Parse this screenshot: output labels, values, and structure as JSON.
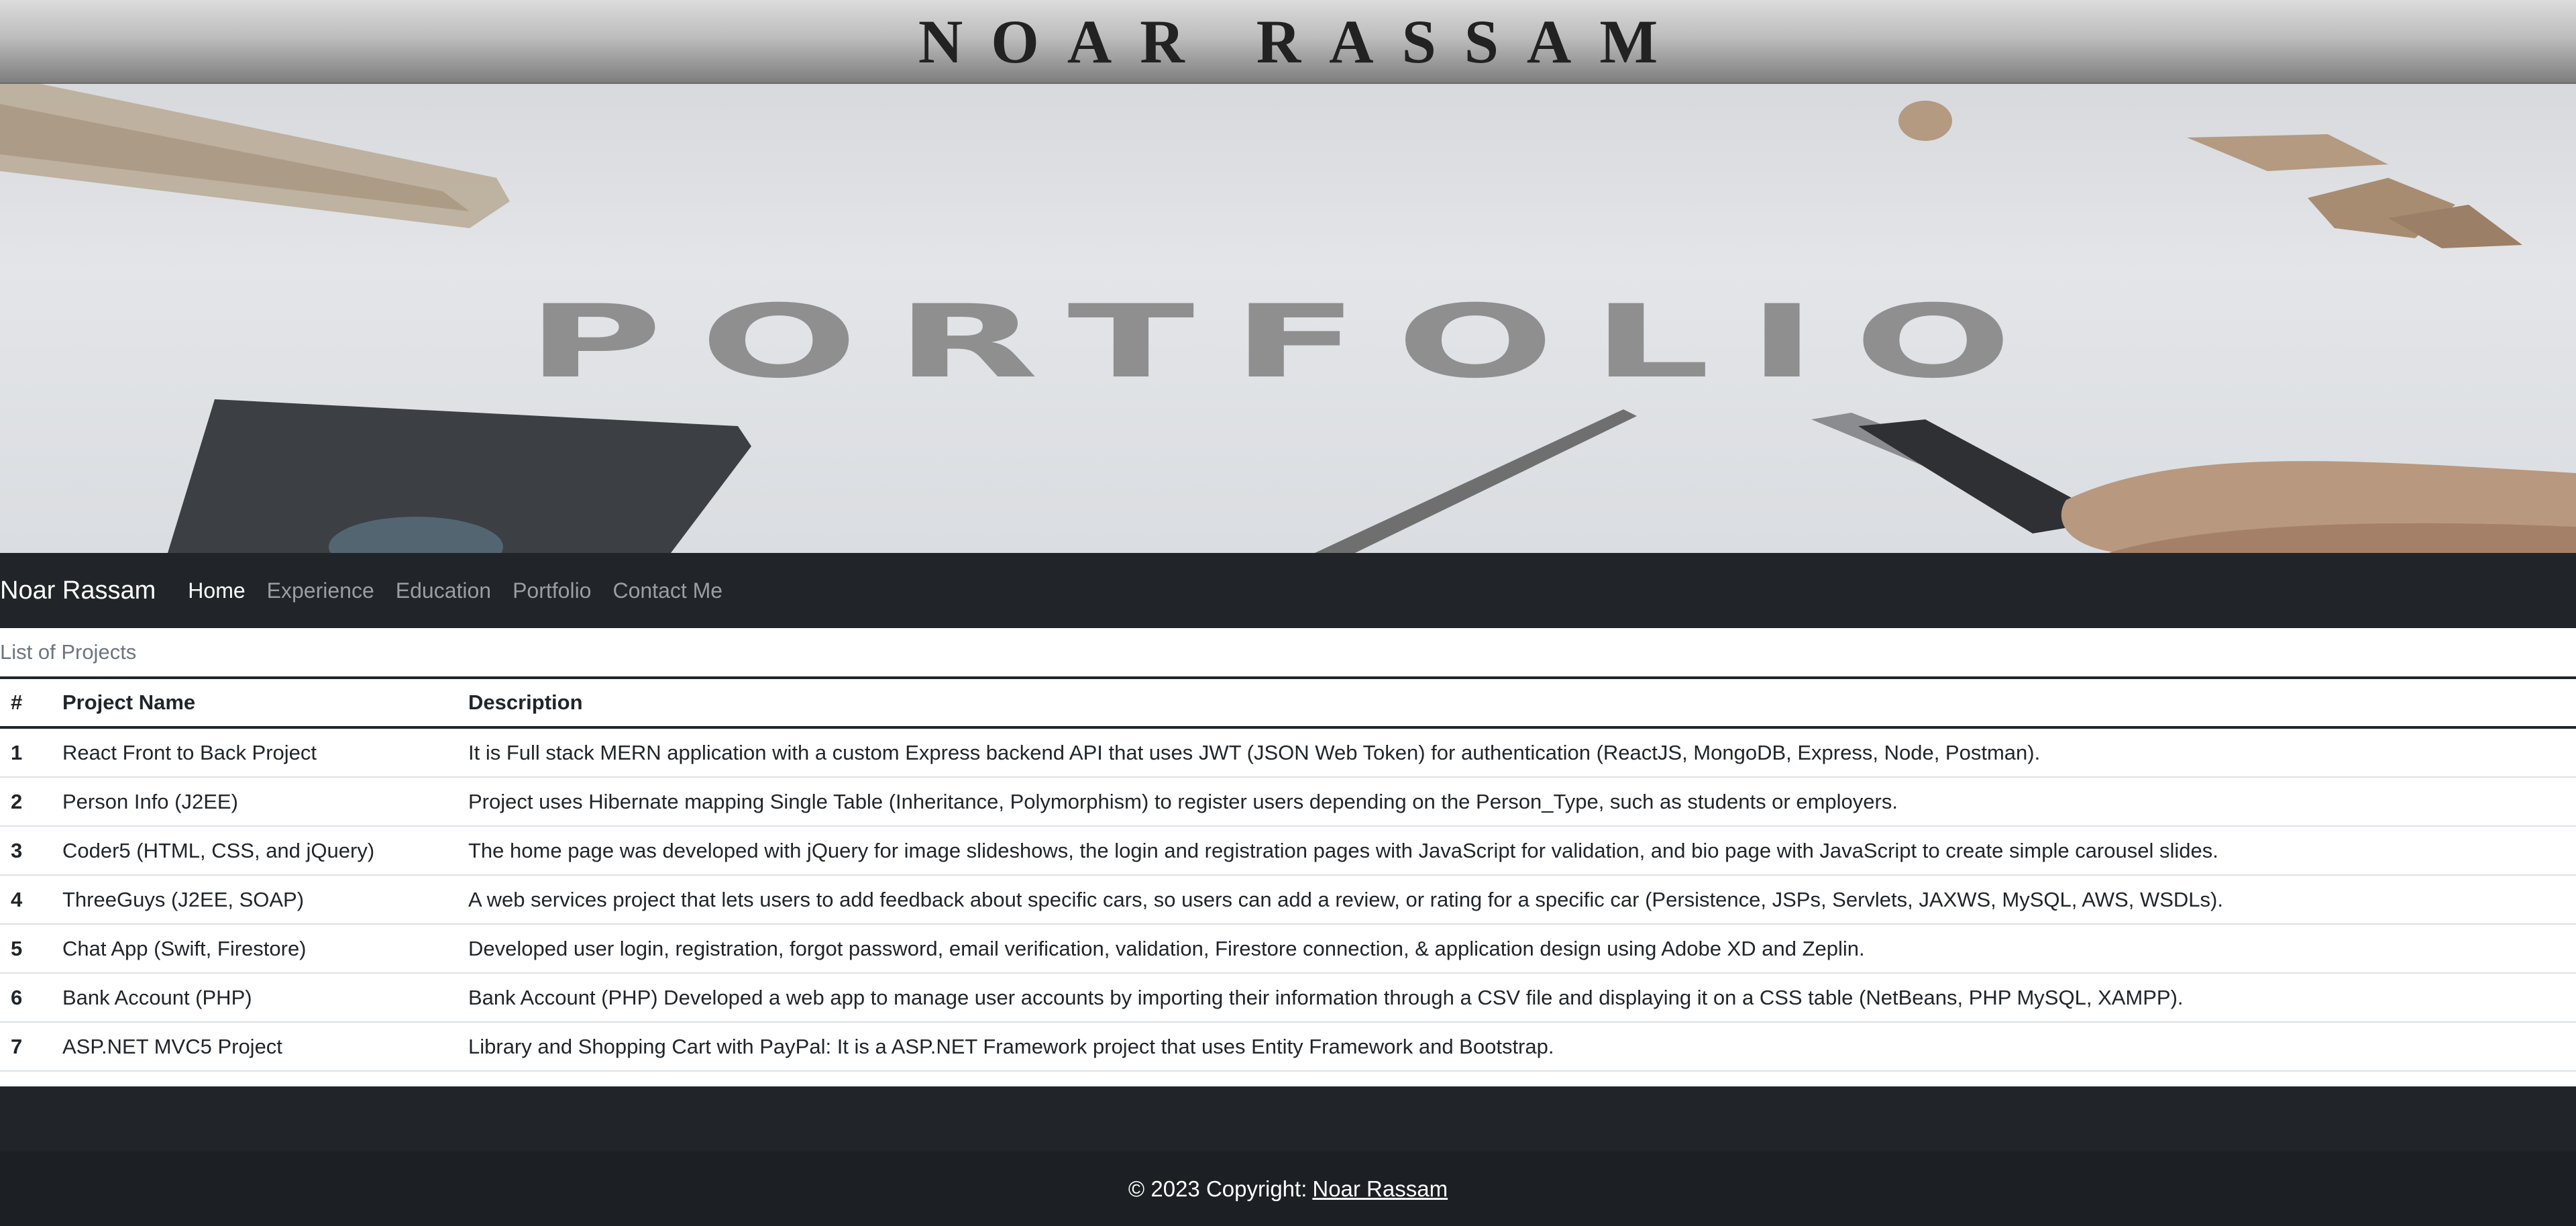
{
  "header": {
    "site_name": "NOAR RASSAM"
  },
  "hero": {
    "title": "PORTFOLIO"
  },
  "navbar": {
    "brand": "Noar Rassam",
    "links": [
      {
        "label": "Home",
        "active": true
      },
      {
        "label": "Experience",
        "active": false
      },
      {
        "label": "Education",
        "active": false
      },
      {
        "label": "Portfolio",
        "active": false
      },
      {
        "label": "Contact Me",
        "active": false
      }
    ]
  },
  "projects": {
    "caption": "List of Projects",
    "columns": [
      "#",
      "Project Name",
      "Description"
    ],
    "rows": [
      {
        "num": "1",
        "name": "React Front to Back Project",
        "description": "It is Full stack MERN application with a custom Express backend API that uses JWT (JSON Web Token) for authentication (ReactJS, MongoDB, Express, Node, Postman)."
      },
      {
        "num": "2",
        "name": "Person Info (J2EE)",
        "description": "Project uses Hibernate mapping Single Table (Inheritance, Polymorphism) to register users depending on the Person_Type, such as students or employers."
      },
      {
        "num": "3",
        "name": "Coder5 (HTML, CSS, and jQuery)",
        "description": "The home page was developed with jQuery for image slideshows, the login and registration pages with JavaScript for validation, and bio page with JavaScript to create simple carousel slides."
      },
      {
        "num": "4",
        "name": "ThreeGuys (J2EE, SOAP)",
        "description": "A web services project that lets users to add feedback about specific cars, so users can add a review, or rating for a specific car (Persistence, JSPs, Servlets, JAXWS, MySQL, AWS, WSDLs)."
      },
      {
        "num": "5",
        "name": "Chat App (Swift, Firestore)",
        "description": "Developed user login, registration, forgot password, email verification, validation, Firestore connection, & application design using Adobe XD and Zeplin."
      },
      {
        "num": "6",
        "name": "Bank Account (PHP)",
        "description": "Bank Account (PHP) Developed a web app to manage user accounts by importing their information through a CSV file and displaying it on a CSS table (NetBeans, PHP MySQL, XAMPP)."
      },
      {
        "num": "7",
        "name": "ASP.NET MVC5 Project",
        "description": "Library and Shopping Cart with PayPal: It is a ASP.NET Framework project that uses Entity Framework and Bootstrap."
      }
    ]
  },
  "footer": {
    "copyright": "© 2023 Copyright:",
    "link": "Noar Rassam"
  },
  "colors": {
    "navbar_bg": "#212529",
    "footer_bg": "#1c1f23"
  }
}
